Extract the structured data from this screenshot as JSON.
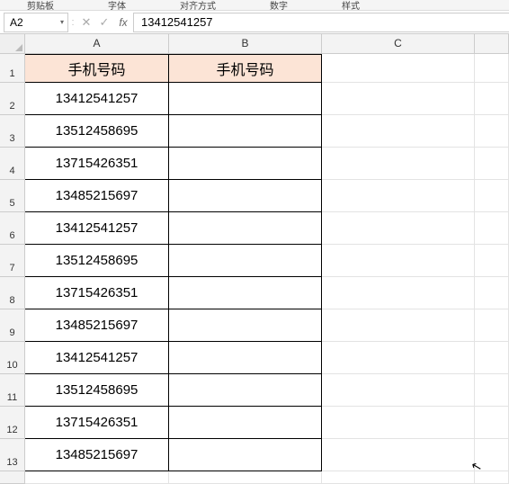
{
  "ribbon": {
    "groups": [
      "剪贴板",
      "字体",
      "对齐方式",
      "数字",
      "样式"
    ]
  },
  "namebox": {
    "value": "A2",
    "dropdown_glyph": "▾"
  },
  "fxbar": {
    "sep": ":",
    "cancel": "✕",
    "enter": "✓",
    "fx": "fx",
    "value": "13412541257"
  },
  "columns": [
    "A",
    "B",
    "C",
    ""
  ],
  "header": {
    "A": "手机号码",
    "B": "手机号码"
  },
  "rows": [
    {
      "n": "1"
    },
    {
      "n": "2",
      "A": "13412541257"
    },
    {
      "n": "3",
      "A": "13512458695"
    },
    {
      "n": "4",
      "A": "13715426351"
    },
    {
      "n": "5",
      "A": "13485215697"
    },
    {
      "n": "6",
      "A": "13412541257"
    },
    {
      "n": "7",
      "A": "13512458695"
    },
    {
      "n": "8",
      "A": "13715426351"
    },
    {
      "n": "9",
      "A": "13485215697"
    },
    {
      "n": "10",
      "A": "13412541257"
    },
    {
      "n": "11",
      "A": "13512458695"
    },
    {
      "n": "12",
      "A": "13715426351"
    },
    {
      "n": "13",
      "A": "13485215697"
    }
  ],
  "cursor_glyph": "↖"
}
